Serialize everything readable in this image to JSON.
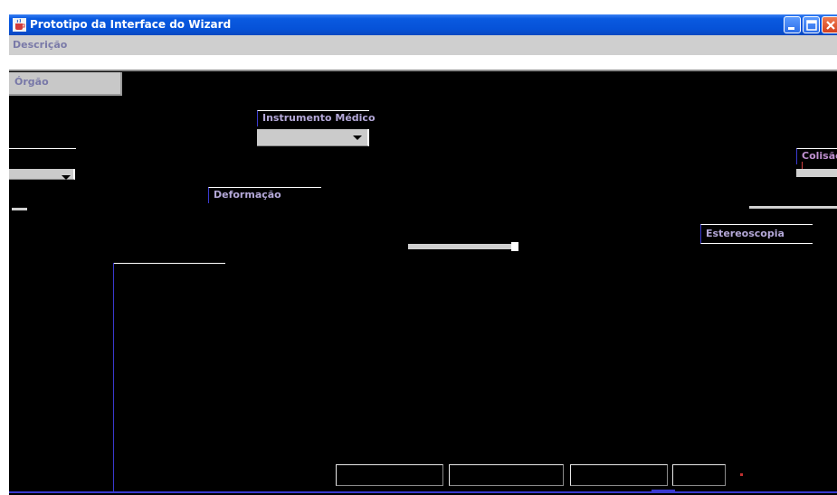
{
  "window": {
    "title": "Prototipo da Interface do Wizard"
  },
  "descricao": {
    "label": "Descrição",
    "value": ""
  },
  "orgao": {
    "label": "Órgão",
    "selected": ""
  },
  "instrumento": {
    "label": "Instrumento Médico",
    "selected": ""
  },
  "deformacao": {
    "label": "Deformação"
  },
  "colisao": {
    "label": "Colisão"
  },
  "estereoscopia": {
    "label": "Estereoscopia"
  },
  "buttons": [
    {
      "label": ""
    },
    {
      "label": ""
    },
    {
      "label": ""
    },
    {
      "label": ""
    }
  ],
  "colors": {
    "titlebar": "#0652d8",
    "panel": "#c8c8c8",
    "label_text": "#7878a8",
    "canvas": "#000000",
    "border_accent": "#3a3ad0"
  },
  "icons": {
    "app": "java-coffee-cup-icon",
    "minimize": "minimize-icon",
    "maximize": "maximize-icon",
    "close": "close-icon"
  }
}
